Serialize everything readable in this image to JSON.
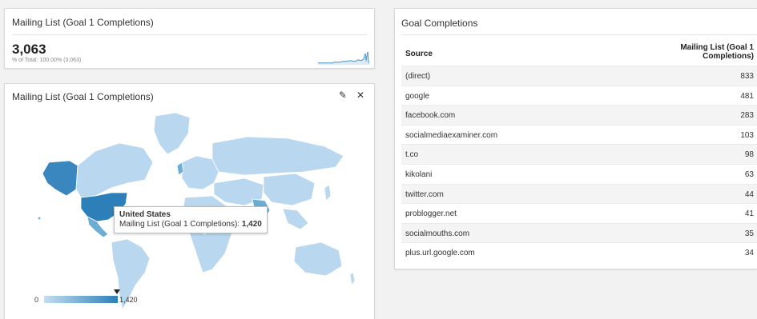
{
  "scorecard": {
    "title": "Mailing List (Goal 1 Completions)",
    "value": "3,063",
    "percent_of_total": "% of Total: 100.00% (3,063)"
  },
  "map_widget": {
    "title": "Mailing List (Goal 1 Completions)",
    "icons": [
      "pencil-icon",
      "close-icon"
    ],
    "close_glyph": "✕",
    "edit_glyph": "✎",
    "tooltip": {
      "country": "United States",
      "metric_label": "Mailing List (Goal 1 Completions): ",
      "metric_value": "1,420"
    },
    "legend": {
      "min": "0",
      "max": "1,420"
    },
    "colors": {
      "max": "#2c7fb8",
      "mid": "#6aaed6",
      "light": "#b9d7ee",
      "empty": "#e6e6e6"
    }
  },
  "table_widget": {
    "title": "Goal Completions",
    "header": {
      "source": "Source",
      "metric": "Mailing List (Goal 1 Completions)"
    },
    "rows": [
      {
        "source": "(direct)",
        "value": "833"
      },
      {
        "source": "google",
        "value": "481"
      },
      {
        "source": "facebook.com",
        "value": "283"
      },
      {
        "source": "socialmediaexaminer.com",
        "value": "103"
      },
      {
        "source": "t.co",
        "value": "98"
      },
      {
        "source": "kikolani",
        "value": "63"
      },
      {
        "source": "twitter.com",
        "value": "44"
      },
      {
        "source": "problogger.net",
        "value": "41"
      },
      {
        "source": "socialmouths.com",
        "value": "35"
      },
      {
        "source": "plus.url.google.com",
        "value": "34"
      }
    ]
  }
}
